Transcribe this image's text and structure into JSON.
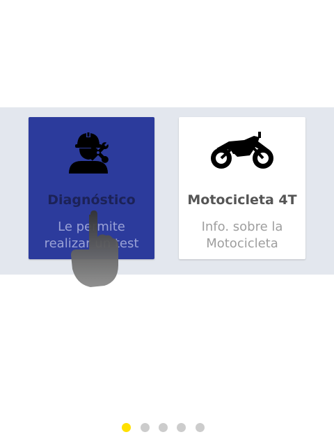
{
  "cards": [
    {
      "title": "Diagnóstico",
      "description_line1": "Le permite",
      "description_line2": "realizar un test",
      "icon": "mechanic-worker-icon",
      "selected": true,
      "background": "#2c3b9c"
    },
    {
      "title": "Motocicleta 4T",
      "description_line1": "Info. sobre la",
      "description_line2": "Motocicleta",
      "icon": "motorcycle-icon",
      "selected": false,
      "background": "#ffffff"
    }
  ],
  "pager": {
    "count": 5,
    "active_index": 0,
    "active_color": "#ffe000",
    "inactive_color": "#cccccc"
  },
  "overlay": {
    "icon": "hand-pointer-icon"
  }
}
